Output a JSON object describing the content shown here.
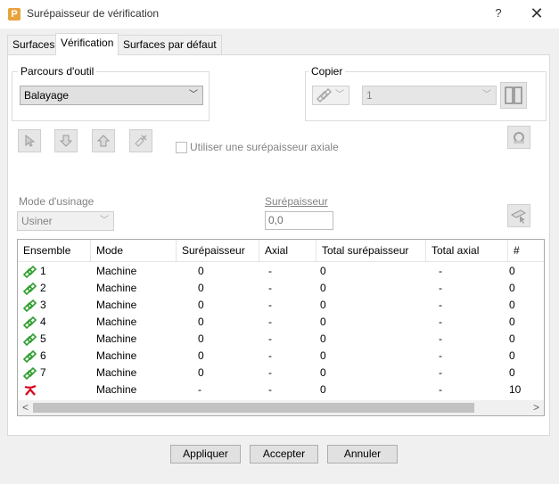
{
  "window": {
    "title": "Surépaisseur de vérification",
    "app_icon_letter": "P",
    "help_label": "?",
    "close_label": "✕"
  },
  "tabs": [
    {
      "label": "Surfaces",
      "active": false
    },
    {
      "label": "Vérification",
      "active": true
    },
    {
      "label": "Surfaces par défaut",
      "active": false
    }
  ],
  "toolpath_group": {
    "label": "Parcours d'outil",
    "selected": "Balayage"
  },
  "copy_group": {
    "label": "Copier",
    "value": "1"
  },
  "axial_checkbox": {
    "label": "Utiliser une surépaisseur axiale",
    "checked": false
  },
  "machining_mode": {
    "label": "Mode d'usinage",
    "selected": "Usiner"
  },
  "thickness": {
    "label": "Surépaisseur",
    "value": "0,0"
  },
  "table": {
    "columns": [
      "Ensemble",
      "Mode",
      "Surépaisseur",
      "Axial",
      "Total surépaisseur",
      "Total axial",
      "#"
    ],
    "rows": [
      {
        "set": "1",
        "icon": "surface-set-icon",
        "mode": "Machine",
        "thickness": "0",
        "axial": "-",
        "total": "0",
        "total_axial": "-",
        "count": "0"
      },
      {
        "set": "2",
        "icon": "surface-set-icon",
        "mode": "Machine",
        "thickness": "0",
        "axial": "-",
        "total": "0",
        "total_axial": "-",
        "count": "0"
      },
      {
        "set": "3",
        "icon": "surface-set-icon",
        "mode": "Machine",
        "thickness": "0",
        "axial": "-",
        "total": "0",
        "total_axial": "-",
        "count": "0"
      },
      {
        "set": "4",
        "icon": "surface-set-icon",
        "mode": "Machine",
        "thickness": "0",
        "axial": "-",
        "total": "0",
        "total_axial": "-",
        "count": "0"
      },
      {
        "set": "5",
        "icon": "surface-set-icon",
        "mode": "Machine",
        "thickness": "0",
        "axial": "-",
        "total": "0",
        "total_axial": "-",
        "count": "0"
      },
      {
        "set": "6",
        "icon": "surface-set-icon",
        "mode": "Machine",
        "thickness": "0",
        "axial": "-",
        "total": "0",
        "total_axial": "-",
        "count": "0"
      },
      {
        "set": "7",
        "icon": "surface-set-icon",
        "mode": "Machine",
        "thickness": "0",
        "axial": "-",
        "total": "0",
        "total_axial": "-",
        "count": "0"
      },
      {
        "set": "",
        "icon": "unassigned-x-icon",
        "mode": "Machine",
        "thickness": "-",
        "axial": "-",
        "total": "0",
        "total_axial": "-",
        "count": "10"
      }
    ],
    "scroll_left": "<",
    "scroll_right": ">"
  },
  "buttons": {
    "apply": "Appliquer",
    "accept": "Accepter",
    "cancel": "Annuler"
  },
  "colors": {
    "set_icon_green": "#2e9e2e",
    "unassigned_red": "#d9001b",
    "app_icon": "#e8a33d"
  }
}
